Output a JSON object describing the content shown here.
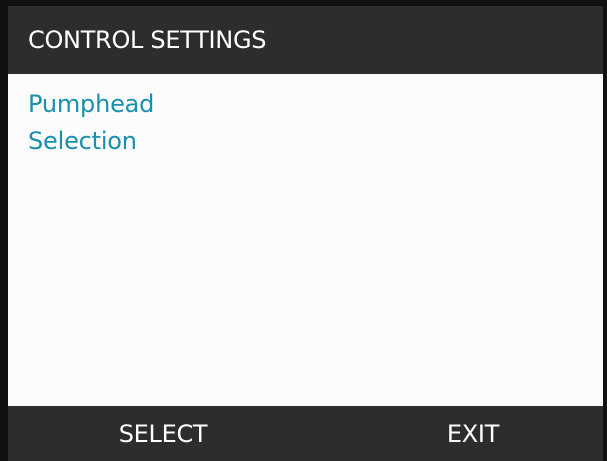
{
  "header": {
    "title": "CONTROL SETTINGS"
  },
  "menu": {
    "items": [
      {
        "line1": "Pumphead",
        "line2": "Selection"
      }
    ]
  },
  "footer": {
    "select_label": "SELECT",
    "exit_label": "EXIT"
  },
  "colors": {
    "header_bg": "#2e2d2d",
    "footer_bg": "#2e2d2d",
    "menu_text": "#1a8fae",
    "content_bg": "#fcfcfc"
  }
}
